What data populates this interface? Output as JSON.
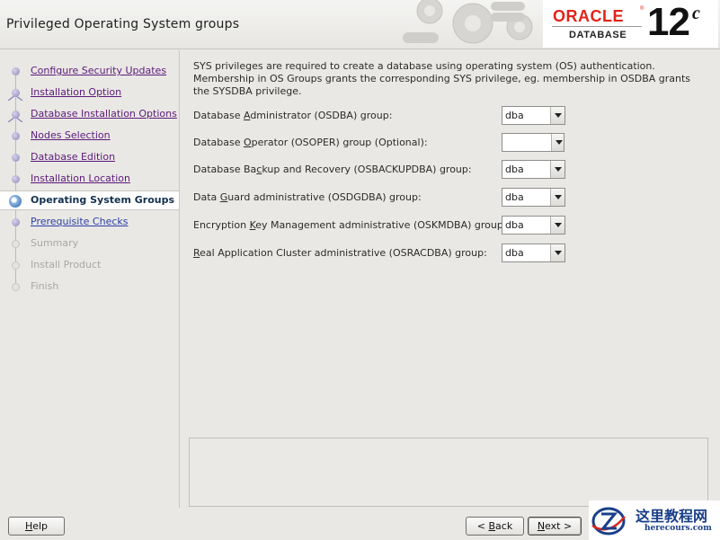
{
  "window": {
    "title": "Privileged Operating System groups"
  },
  "brand": {
    "oracle": "ORACLE",
    "registered": "®",
    "database": "DATABASE",
    "version": "12",
    "version_suffix": "c",
    "color": "#e2231a"
  },
  "nav": {
    "items": [
      {
        "label": "Configure Security Updates",
        "state": "done"
      },
      {
        "label": "Installation Option",
        "state": "done"
      },
      {
        "label": "Database Installation Options",
        "state": "done"
      },
      {
        "label": "Nodes Selection",
        "state": "done"
      },
      {
        "label": "Database Edition",
        "state": "done"
      },
      {
        "label": "Installation Location",
        "state": "done"
      },
      {
        "label": "Operating System Groups",
        "state": "current"
      },
      {
        "label": "Prerequisite Checks",
        "state": "next"
      },
      {
        "label": "Summary",
        "state": "future"
      },
      {
        "label": "Install Product",
        "state": "future"
      },
      {
        "label": "Finish",
        "state": "future"
      }
    ]
  },
  "main": {
    "intro": "SYS privileges are required to create a database using operating system (OS) authentication. Membership in OS Groups grants the corresponding SYS privilege, eg. membership in OSDBA grants the SYSDBA privilege.",
    "groups": [
      {
        "pre": "Database ",
        "mnemonic": "A",
        "post": "dministrator (OSDBA) group:",
        "value": "dba"
      },
      {
        "pre": "Database ",
        "mnemonic": "O",
        "post": "perator (OSOPER) group (Optional):",
        "value": ""
      },
      {
        "pre": "Database Ba",
        "mnemonic": "c",
        "post": "kup and Recovery (OSBACKUPDBA) group:",
        "value": "dba"
      },
      {
        "pre": "Data ",
        "mnemonic": "G",
        "post": "uard administrative (OSDGDBA) group:",
        "value": "dba"
      },
      {
        "pre": "Encryption ",
        "mnemonic": "K",
        "post": "ey Management administrative (OSKMDBA) group:",
        "value": "dba"
      },
      {
        "pre": "",
        "mnemonic": "R",
        "post": "eal Application Cluster administrative (OSRACDBA) group:",
        "value": "dba"
      }
    ]
  },
  "footer": {
    "help": {
      "pre": "",
      "mnemonic": "H",
      "post": "elp"
    },
    "back": {
      "pre": "< ",
      "mnemonic": "B",
      "post": "ack"
    },
    "next": {
      "pre": "",
      "mnemonic": "N",
      "post": "ext >"
    }
  },
  "watermark": {
    "cn": "这里教程网",
    "en": "herecours.com"
  }
}
